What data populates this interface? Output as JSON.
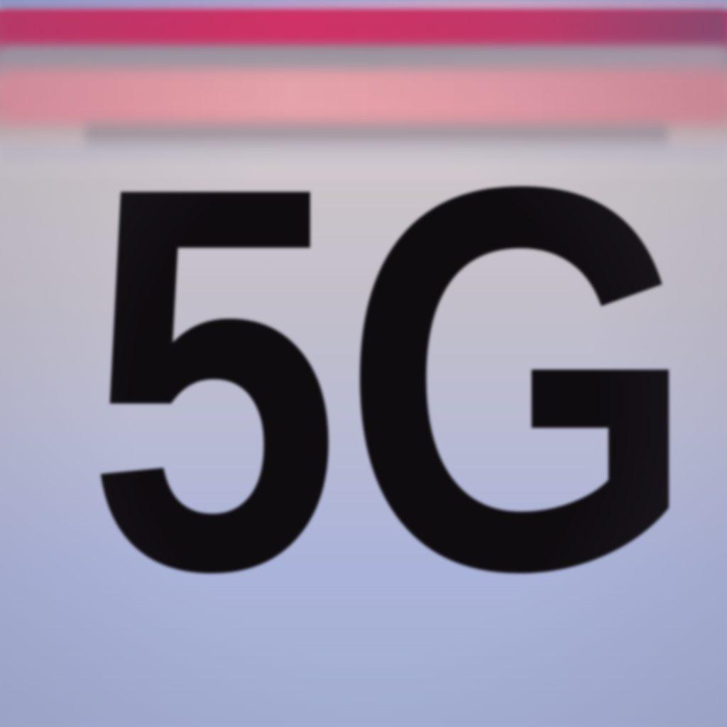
{
  "image": {
    "description_kind": "close-up photograph of a device label",
    "label_text": "5G",
    "colors": {
      "label": "#0f0c10",
      "background": "#c3bfca",
      "top_magenta": "#d1285e",
      "top_pink": "#e39aa0"
    }
  }
}
